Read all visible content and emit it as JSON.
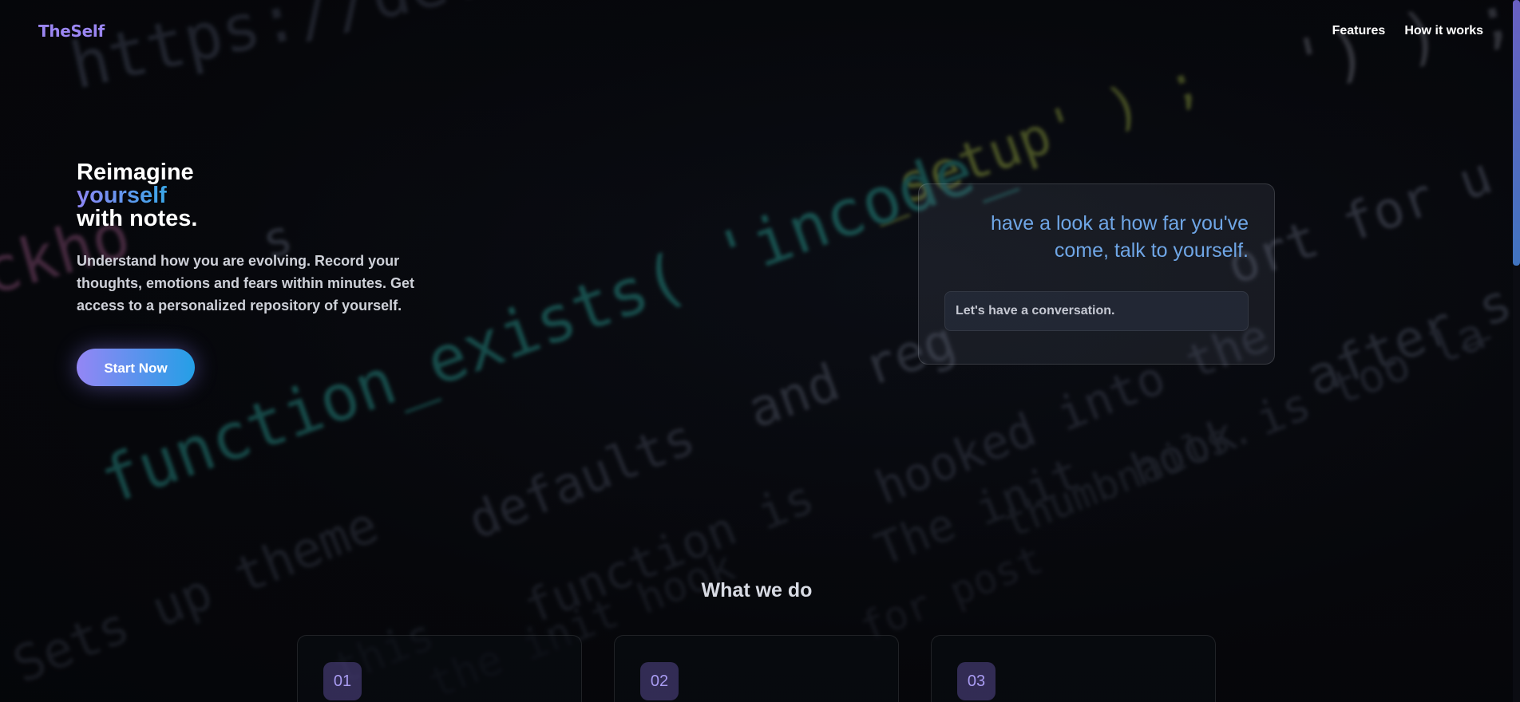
{
  "nav": {
    "logo": "TheSelf",
    "links": [
      "Features",
      "How it works"
    ]
  },
  "hero": {
    "title_line1": "Reimagine",
    "title_line2": "yourself",
    "title_line3": "with notes.",
    "description": "Understand how you are evolving. Record your thoughts, emotions and fears within minutes. Get access to a personalized repository of yourself.",
    "cta_label": "Start Now"
  },
  "card": {
    "tagline": "have a look at how far you've come, talk to yourself.",
    "input_placeholder": "Let's have a conversation."
  },
  "section": {
    "title": "What we do",
    "features": [
      {
        "number": "01"
      },
      {
        "number": "02"
      },
      {
        "number": "03"
      }
    ]
  },
  "background_code": [
    "https://devel",
    "') ) ;",
    "_setup' ) ;",
    "ckho",
    "s",
    "function_exists( 'incode_",
    "ort  for  u",
    "and  reg",
    "after_s",
    "defaults",
    "hooked  into  the",
    "hook  is  too  la",
    "Sets  up  theme",
    "function  is",
    "The  init",
    "thumbnails.",
    "this",
    "the  init  hook",
    "for  post"
  ],
  "colors": {
    "brand": "#9b86f2",
    "gradient_start": "#9486f5",
    "gradient_end": "#249fe6",
    "tagline": "#6fa6e6"
  }
}
